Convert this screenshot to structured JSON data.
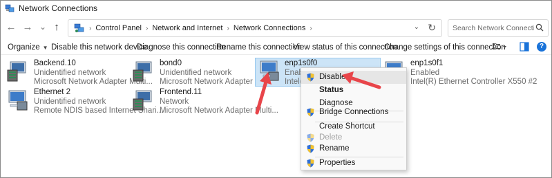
{
  "window": {
    "title": "Network Connections",
    "icon": "network-connections-icon"
  },
  "nav": {
    "back": "←",
    "forward": "→",
    "down": "⌄",
    "up": "↑",
    "breadcrumbs": [
      "Control Panel",
      "Network and Internet",
      "Network Connections"
    ],
    "separator": "›",
    "dropdown": "⌄",
    "refresh": "↻"
  },
  "search": {
    "placeholder": "Search Network Connections"
  },
  "commands": {
    "organize": "Organize",
    "disable": "Disable this network device",
    "diagnose": "Diagnose this connection",
    "rename": "Rename this connection",
    "view_status": "View status of this connection",
    "change_settings": "Change settings of this connection",
    "help": "?"
  },
  "connections": [
    {
      "name": "Backend.10",
      "status": "Unidentified network",
      "device": "Microsoft Network Adapter Multi..."
    },
    {
      "name": "bond0",
      "status": "Unidentified network",
      "device": "Microsoft Network Adapter Multi..."
    },
    {
      "name": "enp1s0f0",
      "status": "Enable",
      "device": "Intel(R"
    },
    {
      "name": "enp1s0f1",
      "status": "Enabled",
      "device": "Intel(R) Ethernet Controller X550 #2"
    },
    {
      "name": "Ethernet 2",
      "status": "Unidentified network",
      "device": "Remote NDIS based Internet Shari..."
    },
    {
      "name": "Frontend.11",
      "status": "Network",
      "device": "Microsoft Network Adapter Multi..."
    }
  ],
  "context_menu": {
    "disable": "Disable",
    "status": "Status",
    "diagnose": "Diagnose",
    "bridge": "Bridge Connections",
    "shortcut": "Create Shortcut",
    "delete": "Delete",
    "rename": "Rename",
    "properties": "Properties"
  },
  "colors": {
    "selection": "#cce4f7",
    "annotation_arrow": "#e8454a",
    "help_blue": "#1a73d9"
  }
}
